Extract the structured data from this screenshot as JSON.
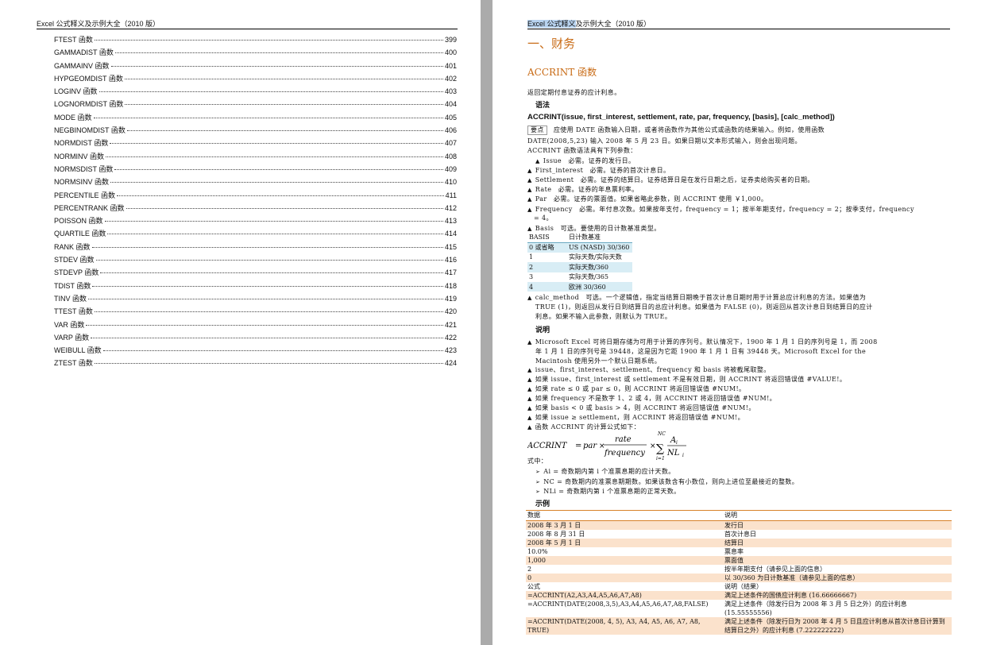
{
  "left_page": {
    "running_header": "Excel 公式释义及示例大全（2010 版）",
    "toc": [
      {
        "name": "FTEST 函数",
        "page": "399"
      },
      {
        "name": "GAMMADIST 函数",
        "page": "400"
      },
      {
        "name": "GAMMAINV 函数",
        "page": "401"
      },
      {
        "name": "HYPGEOMDIST 函数",
        "page": "402"
      },
      {
        "name": "LOGINV 函数",
        "page": "403"
      },
      {
        "name": "LOGNORMDIST 函数",
        "page": "404"
      },
      {
        "name": "MODE 函数",
        "page": "405"
      },
      {
        "name": "NEGBINOMDIST 函数",
        "page": "406"
      },
      {
        "name": "NORMDIST 函数",
        "page": "407"
      },
      {
        "name": "NORMINV 函数",
        "page": "408"
      },
      {
        "name": "NORMSDIST 函数",
        "page": "409"
      },
      {
        "name": "NORMSINV 函数",
        "page": "410"
      },
      {
        "name": "PERCENTILE 函数",
        "page": "411"
      },
      {
        "name": "PERCENTRANK 函数",
        "page": "412"
      },
      {
        "name": "POISSON 函数",
        "page": "413"
      },
      {
        "name": "QUARTILE 函数",
        "page": "414"
      },
      {
        "name": "RANK 函数",
        "page": "415"
      },
      {
        "name": "STDEV 函数",
        "page": "416"
      },
      {
        "name": "STDEVP 函数",
        "page": "417"
      },
      {
        "name": "TDIST 函数",
        "page": "418"
      },
      {
        "name": "TINV 函数",
        "page": "419"
      },
      {
        "name": "TTEST 函数",
        "page": "420"
      },
      {
        "name": "VAR 函数",
        "page": "421"
      },
      {
        "name": "VARP 函数",
        "page": "422"
      },
      {
        "name": "WEIBULL 函数",
        "page": "423"
      },
      {
        "name": "ZTEST 函数",
        "page": "424"
      }
    ]
  },
  "right_page": {
    "running_header_selected": "Excel 公式释义",
    "running_header_rest": "及示例大全（2010 版）",
    "section_title": "一、财务",
    "function_title": "ACCRINT 函数",
    "intro": "返回定期付息证券的应计利息。",
    "syntax_heading": "语法",
    "syntax": "ACCRINT(issue, first_interest, settlement, rate, par, frequency, [basis], [calc_method])",
    "note_label": "要点",
    "note_line1": "应使用 DATE 函数输入日期，或者将函数作为其他公式或函数的结果输入。例如，使用函数",
    "note_line2": "DATE(2008,5,23) 输入 2008 年 5 月 23 日。如果日期以文本形式输入，则会出现问题。",
    "params_intro": "ACCRINT 函数语法具有下列参数：",
    "params": [
      "Issue　必需。证券的发行日。",
      "First_interest　必需。证券的首次计息日。",
      "Settlement　必需。证券的结算日。证券结算日是在发行日期之后，证券卖给购买者的日期。",
      "Rate　必需。证券的年息票利率。",
      "Par　必需。证券的票面值。如果省略此参数，则 ACCRINT 使用 ￥1,000。",
      "Frequency　必需。年付息次数。如果按年支付，frequency = 1；按半年期支付，frequency = 2；按季支付，frequency",
      "Basis　可选。要使用的日计数基准类型。"
    ],
    "frequency_cont": "= 4。",
    "basis_table": {
      "headers": [
        "BASIS",
        "日计数基准"
      ],
      "rows": [
        [
          "0 或省略",
          "US (NASD) 30/360"
        ],
        [
          "1",
          "实际天数/实际天数"
        ],
        [
          "2",
          "实际天数/360"
        ],
        [
          "3",
          "实际天数/365"
        ],
        [
          "4",
          "欧洲 30/360"
        ]
      ]
    },
    "calc_method": [
      "calc_method　可选。一个逻辑值，指定当结算日期晚于首次计息日期时用于计算总应计利息的方法。如果值为",
      "TRUE (1)，则返回从发行日到结算日的总应计利息。如果值为 FALSE (0)，则返回从首次计息日到结算日的应计",
      "利息。如果不输入此参数，则默认为 TRUE。"
    ],
    "remarks_heading": "说明",
    "remarks": [
      "Microsoft Excel 可将日期存储为可用于计算的序列号。默认情况下，1900 年 1 月 1 日的序列号是 1，而 2008",
      "年 1 月 1 日的序列号是 39448，这是因为它距 1900 年 1 月 1 日有 39448 天。Microsoft Excel for the",
      "Macintosh 使用另外一个默认日期系统。"
    ],
    "remarks_list": [
      "issue、first_interest、settlement、frequency 和 basis 将被截尾取整。",
      "如果 issue、first_interest 或 settlement 不是有效日期，则 ACCRINT 将返回错误值 #VALUE!。",
      "如果 rate ≤ 0 或 par ≤ 0，则 ACCRINT 将返回错误值 #NUM!。",
      "如果 frequency 不是数字 1、2 或 4，则 ACCRINT 将返回错误值 #NUM!。",
      "如果 basis < 0 或 basis > 4，则 ACCRINT 将返回错误值 #NUM!。",
      "如果 issue ≥ settlement，则 ACCRINT 将返回错误值 #NUM!。",
      "函数 ACCRINT 的计算公式如下："
    ],
    "formula": {
      "lhs": "ACCRINT",
      "par": "par",
      "num": "rate",
      "den": "frequency",
      "sum_top": "NC",
      "sum_bottom": "i=1",
      "frac_top": "A",
      "frac_bottom": "NL",
      "sub": "i"
    },
    "where": "式中：",
    "where_list": [
      "Ai = 奇数期内第 i 个准票息期的应计天数。",
      "NC = 奇数期内的准票息期期数。如果该数含有小数位，则向上进位至最接近的整数。",
      "NLi = 奇数期内第 i 个准票息期的正常天数。"
    ],
    "example_heading": "示例",
    "example_table": {
      "headers": [
        "数据",
        "说明"
      ],
      "rows": [
        [
          "2008 年 3 月 1 日",
          "发行日"
        ],
        [
          "2008 年 8 月 31 日",
          "首次计息日"
        ],
        [
          "2008 年 5 月 1 日",
          "结算日"
        ],
        [
          "10.0%",
          "票息率"
        ],
        [
          "1,000",
          "票面值"
        ],
        [
          "2",
          "按半年期支付（请参见上面的信息）"
        ],
        [
          "0",
          "以 30/360 为日计数基准（请参见上面的信息）"
        ],
        [
          "公式",
          "说明（结果）"
        ],
        [
          "=ACCRINT(A2,A3,A4,A5,A6,A7,A8)",
          "满足上述条件的国债应计利息 (16.66666667)"
        ],
        [
          "=ACCRINT(DATE(2008,3,5),A3,A4,A5,A6,A7,A8,FALSE)",
          "满足上述条件（除发行日为 2008 年 3 月 5 日之外）的应计利息 (15.55555556)"
        ],
        [
          "=ACCRINT(DATE(2008, 4, 5), A3, A4, A5, A6, A7, A8, TRUE)",
          "满足上述条件（除发行日为 2008 年 4 月 5 日且应计利息从首次计息日计算到结算日之外）的应计利息 (7.222222222)"
        ]
      ]
    }
  }
}
